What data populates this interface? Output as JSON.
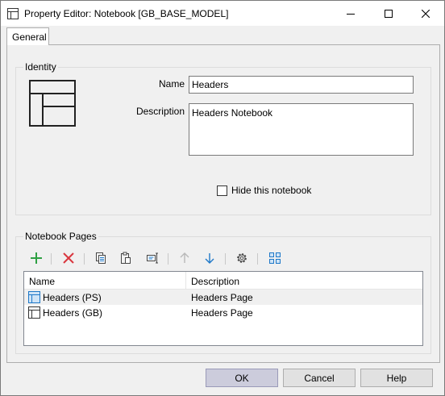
{
  "window": {
    "title": "Property Editor: Notebook [GB_BASE_MODEL]",
    "title_icon": "notebook-icon",
    "controls": [
      "minimize-icon",
      "maximize-icon",
      "close-icon"
    ]
  },
  "tabs": [
    {
      "label": "General",
      "selected": true
    }
  ],
  "identity": {
    "caption": "Identity",
    "icon": "notebook-layout-icon",
    "name_label": "Name",
    "name_value": "Headers",
    "description_label": "Description",
    "description_value": "Headers Notebook",
    "hide_label": "Hide this notebook",
    "hide_checked": false
  },
  "pages": {
    "caption": "Notebook Pages",
    "toolbar": [
      {
        "icon": "add-icon",
        "enabled": true
      },
      {
        "icon": "delete-icon",
        "enabled": true
      },
      {
        "icon": "copy-icon",
        "enabled": true
      },
      {
        "icon": "paste-icon",
        "enabled": true
      },
      {
        "icon": "rename-icon",
        "enabled": true
      },
      {
        "icon": "move-up-icon",
        "enabled": false
      },
      {
        "icon": "move-down-icon",
        "enabled": true
      },
      {
        "icon": "settings-icon",
        "enabled": true
      },
      {
        "icon": "grid-view-icon",
        "enabled": true
      }
    ],
    "columns": [
      "Name",
      "Description"
    ],
    "rows": [
      {
        "name": "Headers (PS)",
        "description": "Headers Page",
        "selected": true
      },
      {
        "name": "Headers (GB)",
        "description": "Headers Page",
        "selected": false
      }
    ]
  },
  "buttons": {
    "ok": "OK",
    "cancel": "Cancel",
    "help": "Help"
  },
  "colors": {
    "accent_blue": "#1e78c8",
    "add_green": "#2ea043",
    "delete_red": "#d9363e"
  }
}
